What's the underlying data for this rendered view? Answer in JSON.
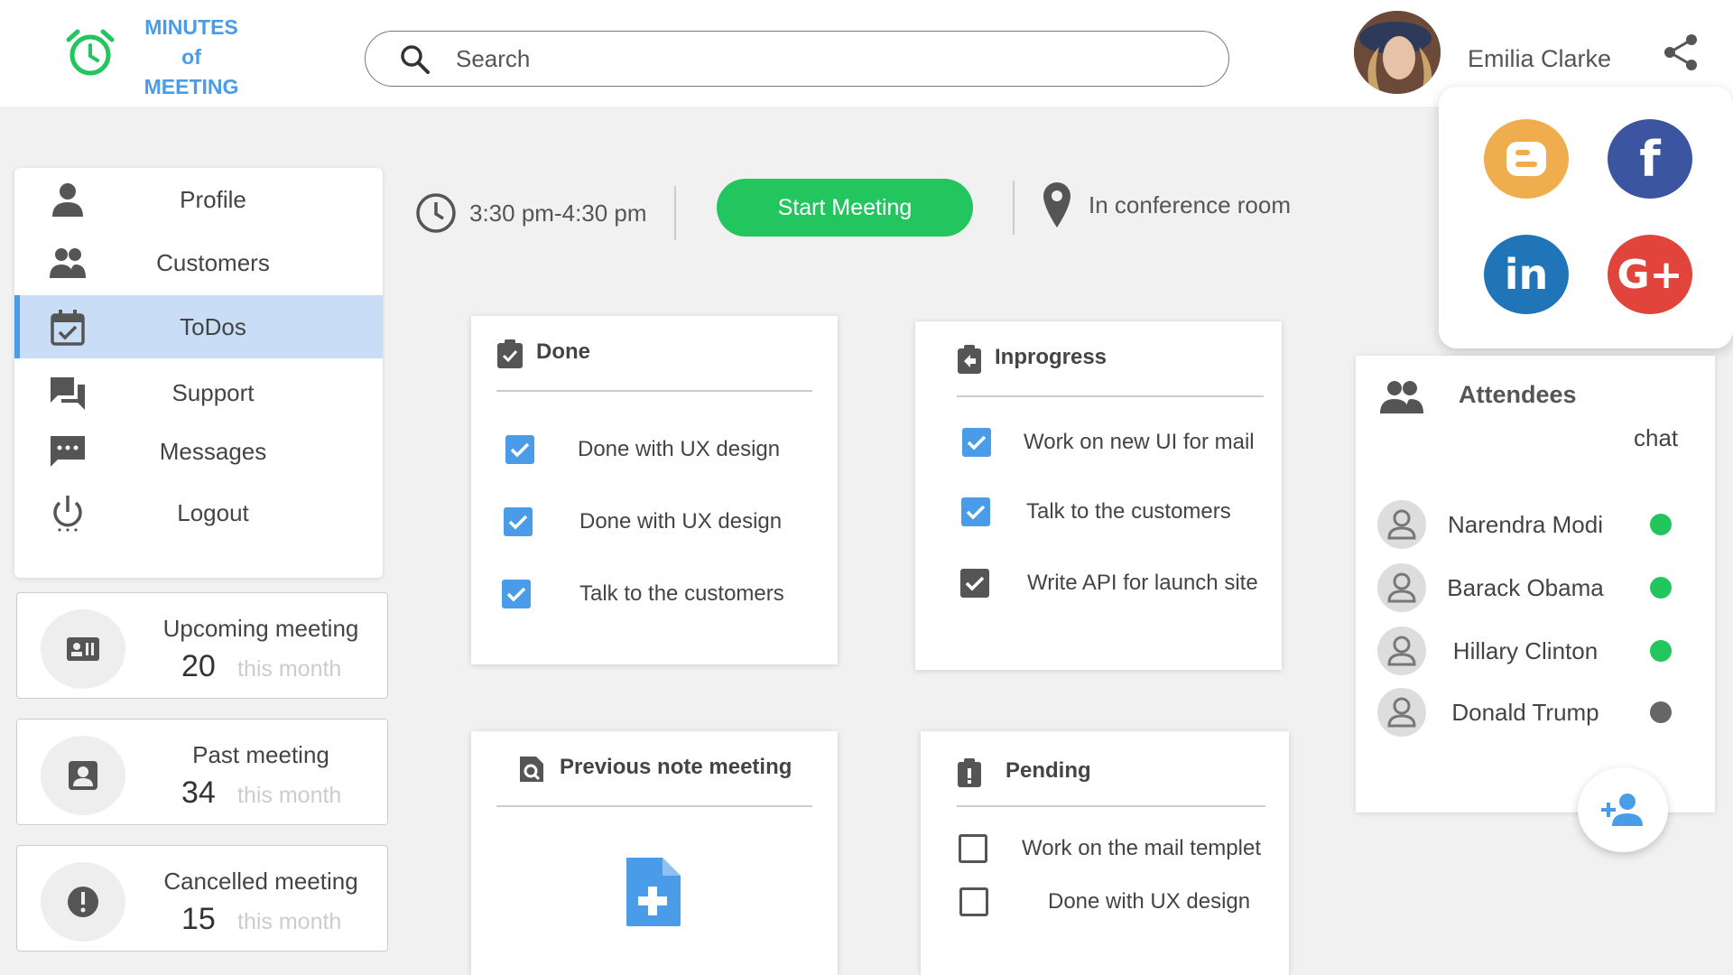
{
  "app": {
    "logo_line1": "MINUTES",
    "logo_line2": "of",
    "logo_line3": "MEETING"
  },
  "search": {
    "placeholder": "Search"
  },
  "user": {
    "name": "Emilia Clarke"
  },
  "social": [
    {
      "name": "Blogger",
      "color": "#f0ad4e"
    },
    {
      "name": "Facebook",
      "color": "#3b55a0"
    },
    {
      "name": "LinkedIn",
      "color": "#1f75b8"
    },
    {
      "name": "Google Plus",
      "color": "#e0443b"
    }
  ],
  "sidebar": {
    "items": [
      {
        "label": "Profile",
        "icon": "person-icon"
      },
      {
        "label": "Customers",
        "icon": "people-icon"
      },
      {
        "label": "ToDos",
        "icon": "calendar-check-icon",
        "active": true
      },
      {
        "label": "Support",
        "icon": "forum-icon"
      },
      {
        "label": "Messages",
        "icon": "message-dots-icon"
      },
      {
        "label": "Logout",
        "icon": "power-icon"
      }
    ]
  },
  "stats": [
    {
      "title": "Upcoming meeting",
      "value": "20",
      "sub": "this month"
    },
    {
      "title": "Past meeting",
      "value": "34",
      "sub": "this month"
    },
    {
      "title": "Cancelled meeting",
      "value": "15",
      "sub": "this month"
    }
  ],
  "meeting": {
    "time": "3:30 pm-4:30 pm",
    "start_label": "Start Meeting",
    "location": "In conference room"
  },
  "done": {
    "title": "Done",
    "tasks": [
      "Done with UX design",
      "Done with UX design",
      "Talk to the customers"
    ]
  },
  "inprogress": {
    "title": "Inprogress",
    "tasks": [
      "Work on new UI for mail",
      "Talk to the customers",
      "Write  API for launch site"
    ]
  },
  "previous": {
    "title": "Previous note meeting"
  },
  "pending": {
    "title": "Pending",
    "tasks": [
      "Work on the mail templet",
      "Done with UX design"
    ]
  },
  "attendees": {
    "title": "Attendees",
    "chat_label": "chat",
    "people": [
      {
        "name": "Narendra Modi",
        "status": "online"
      },
      {
        "name": "Barack Obama",
        "status": "online"
      },
      {
        "name": "Hillary Clinton",
        "status": "online"
      },
      {
        "name": "Donald Trump",
        "status": "offline"
      }
    ]
  },
  "colors": {
    "accent": "#4a9be8",
    "green": "#22c55e",
    "online": "#22c55e",
    "offline": "#666666"
  }
}
